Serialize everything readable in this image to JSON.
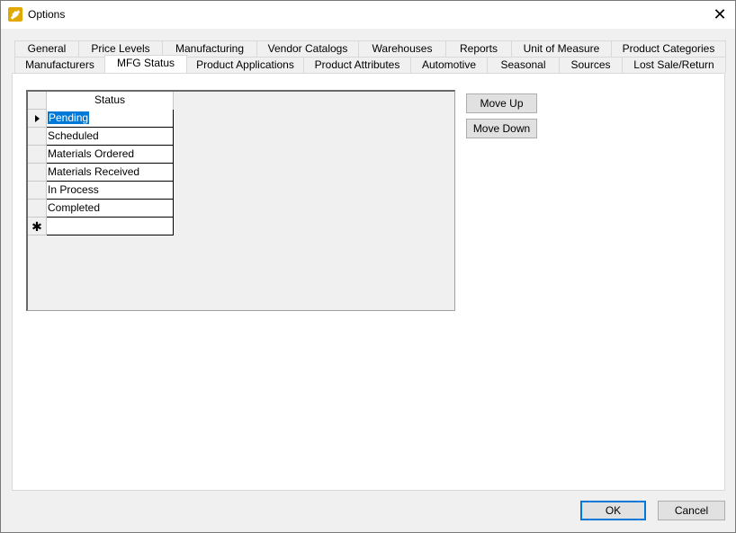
{
  "window": {
    "title": "Options",
    "close_glyph": "✕"
  },
  "tabs_row1": [
    {
      "label": "General"
    },
    {
      "label": "Price Levels"
    },
    {
      "label": "Manufacturing"
    },
    {
      "label": "Vendor Catalogs"
    },
    {
      "label": "Warehouses"
    },
    {
      "label": "Reports"
    },
    {
      "label": "Unit of Measure"
    },
    {
      "label": "Product Categories"
    }
  ],
  "tabs_row2": [
    {
      "label": "Manufacturers"
    },
    {
      "label": "MFG Status",
      "active": true
    },
    {
      "label": "Product Applications"
    },
    {
      "label": "Product Attributes"
    },
    {
      "label": "Automotive"
    },
    {
      "label": "Seasonal"
    },
    {
      "label": "Sources"
    },
    {
      "label": "Lost Sale/Return"
    }
  ],
  "grid": {
    "column_header": "Status",
    "rows": [
      {
        "value": "Pending",
        "current": true
      },
      {
        "value": "Scheduled"
      },
      {
        "value": "Materials Ordered"
      },
      {
        "value": "Materials Received"
      },
      {
        "value": "In Process"
      },
      {
        "value": "Completed"
      }
    ],
    "new_row_glyph": "✱"
  },
  "buttons": {
    "move_up": "Move Up",
    "move_down": "Move Down",
    "ok": "OK",
    "cancel": "Cancel"
  },
  "colors": {
    "selection": "#0078d7",
    "default_button_border": "#0078d7"
  }
}
